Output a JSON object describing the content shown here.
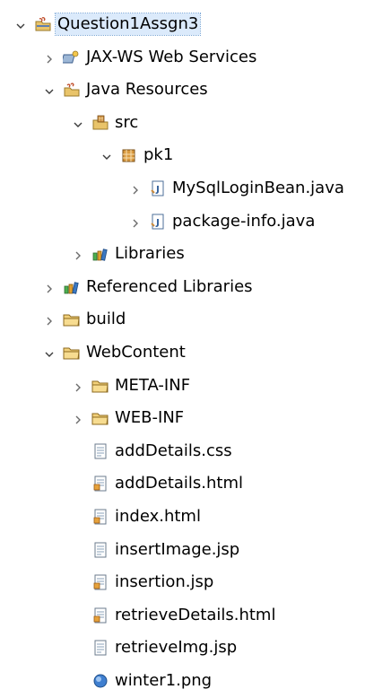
{
  "tree": [
    {
      "label": "Question1Assgn3",
      "icon": "java-ee-project-icon",
      "toggle": "expanded",
      "depth": 0,
      "selected": true
    },
    {
      "label": "JAX-WS Web Services",
      "icon": "web-services-icon",
      "toggle": "collapsed",
      "depth": 1
    },
    {
      "label": "Java Resources",
      "icon": "java-resources-icon",
      "toggle": "expanded",
      "depth": 1
    },
    {
      "label": "src",
      "icon": "source-folder-icon",
      "toggle": "expanded",
      "depth": 2
    },
    {
      "label": "pk1",
      "icon": "package-icon",
      "toggle": "expanded",
      "depth": 3
    },
    {
      "label": "MySqlLoginBean.java",
      "icon": "java-file-icon",
      "toggle": "collapsed",
      "depth": 4
    },
    {
      "label": "package-info.java",
      "icon": "java-file-icon",
      "toggle": "collapsed",
      "depth": 4
    },
    {
      "label": "Libraries",
      "icon": "library-icon",
      "toggle": "collapsed",
      "depth": 2
    },
    {
      "label": "Referenced Libraries",
      "icon": "library-icon",
      "toggle": "collapsed",
      "depth": 1
    },
    {
      "label": "build",
      "icon": "folder-icon",
      "toggle": "collapsed",
      "depth": 1
    },
    {
      "label": "WebContent",
      "icon": "folder-icon",
      "toggle": "expanded",
      "depth": 1
    },
    {
      "label": "META-INF",
      "icon": "folder-icon",
      "toggle": "collapsed",
      "depth": 2
    },
    {
      "label": "WEB-INF",
      "icon": "folder-icon",
      "toggle": "collapsed",
      "depth": 2
    },
    {
      "label": "addDetails.css",
      "icon": "text-file-icon",
      "toggle": "none",
      "depth": 2
    },
    {
      "label": "addDetails.html",
      "icon": "html-file-icon",
      "toggle": "none",
      "depth": 2
    },
    {
      "label": "index.html",
      "icon": "html-file-icon",
      "toggle": "none",
      "depth": 2
    },
    {
      "label": "insertImage.jsp",
      "icon": "text-file-icon",
      "toggle": "none",
      "depth": 2
    },
    {
      "label": "insertion.jsp",
      "icon": "html-file-icon",
      "toggle": "none",
      "depth": 2
    },
    {
      "label": "retrieveDetails.html",
      "icon": "html-file-icon",
      "toggle": "none",
      "depth": 2
    },
    {
      "label": "retrieveImg.jsp",
      "icon": "text-file-icon",
      "toggle": "none",
      "depth": 2
    },
    {
      "label": "winter1.png",
      "icon": "image-file-icon",
      "toggle": "none",
      "depth": 2
    }
  ]
}
